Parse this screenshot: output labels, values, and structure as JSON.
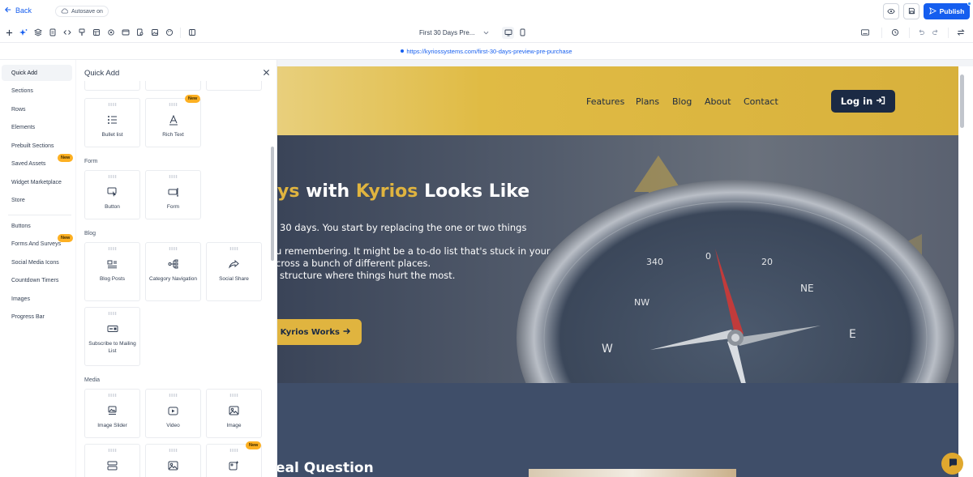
{
  "topbar": {
    "back_label": "Back",
    "autosave_label": "Autosave on",
    "publish_label": "Publish"
  },
  "toolbar": {
    "page_selector": "First 30 Days Pre..."
  },
  "url": {
    "text": "https://kyriossystems.com/first-30-days-preview-pre-purchase"
  },
  "sidebar": {
    "items": [
      {
        "label": "Quick Add"
      },
      {
        "label": "Sections"
      },
      {
        "label": "Rows"
      },
      {
        "label": "Elements"
      },
      {
        "label": "Prebuilt Sections"
      },
      {
        "label": "Saved Assets",
        "badge": "New"
      },
      {
        "label": "Widget Marketplace"
      },
      {
        "label": "Store"
      },
      {
        "label": "Buttons"
      },
      {
        "label": "Forms And Surveys",
        "badge": "New"
      },
      {
        "label": "Social Media Icons"
      },
      {
        "label": "Countdown Timers"
      },
      {
        "label": "Images"
      },
      {
        "label": "Progress Bar"
      }
    ]
  },
  "panel": {
    "title": "Quick Add",
    "sections": {
      "form": "Form",
      "blog": "Blog",
      "media": "Media"
    },
    "cards": {
      "bullet_list": "Bullet list",
      "rich_text": "Rich Text",
      "button": "Button",
      "form": "Form",
      "blog_posts": "Blog Posts",
      "category_navigation": "Category Navigation",
      "social_share": "Social Share",
      "subscribe": "Subscribe to Mailing List",
      "image_slider": "Image Slider",
      "video": "Video",
      "image": "Image"
    },
    "badge_new": "New"
  },
  "site": {
    "nav": [
      "Features",
      "Plans",
      "Blog",
      "About",
      "Contact"
    ],
    "login_label": "Log in",
    "hero_heading": {
      "part1": "ys",
      "part2": " with ",
      "part3": "Kyrios",
      "part4": " Looks Like"
    },
    "hero_lines": [
      "30 days. You start by replacing the one or two things",
      "u remembering. It might be a to-do list that's stuck in your",
      "cross a bunch of different places.",
      "structure where things hurt the most."
    ],
    "hero_button": "w Kyrios Works",
    "section2_heading": "eal Question"
  },
  "colors": {
    "accent_blue": "#155eef",
    "brand_gold": "#e0b43f",
    "brand_navy": "#1b2a44",
    "badge_yellow": "#fdb022"
  }
}
